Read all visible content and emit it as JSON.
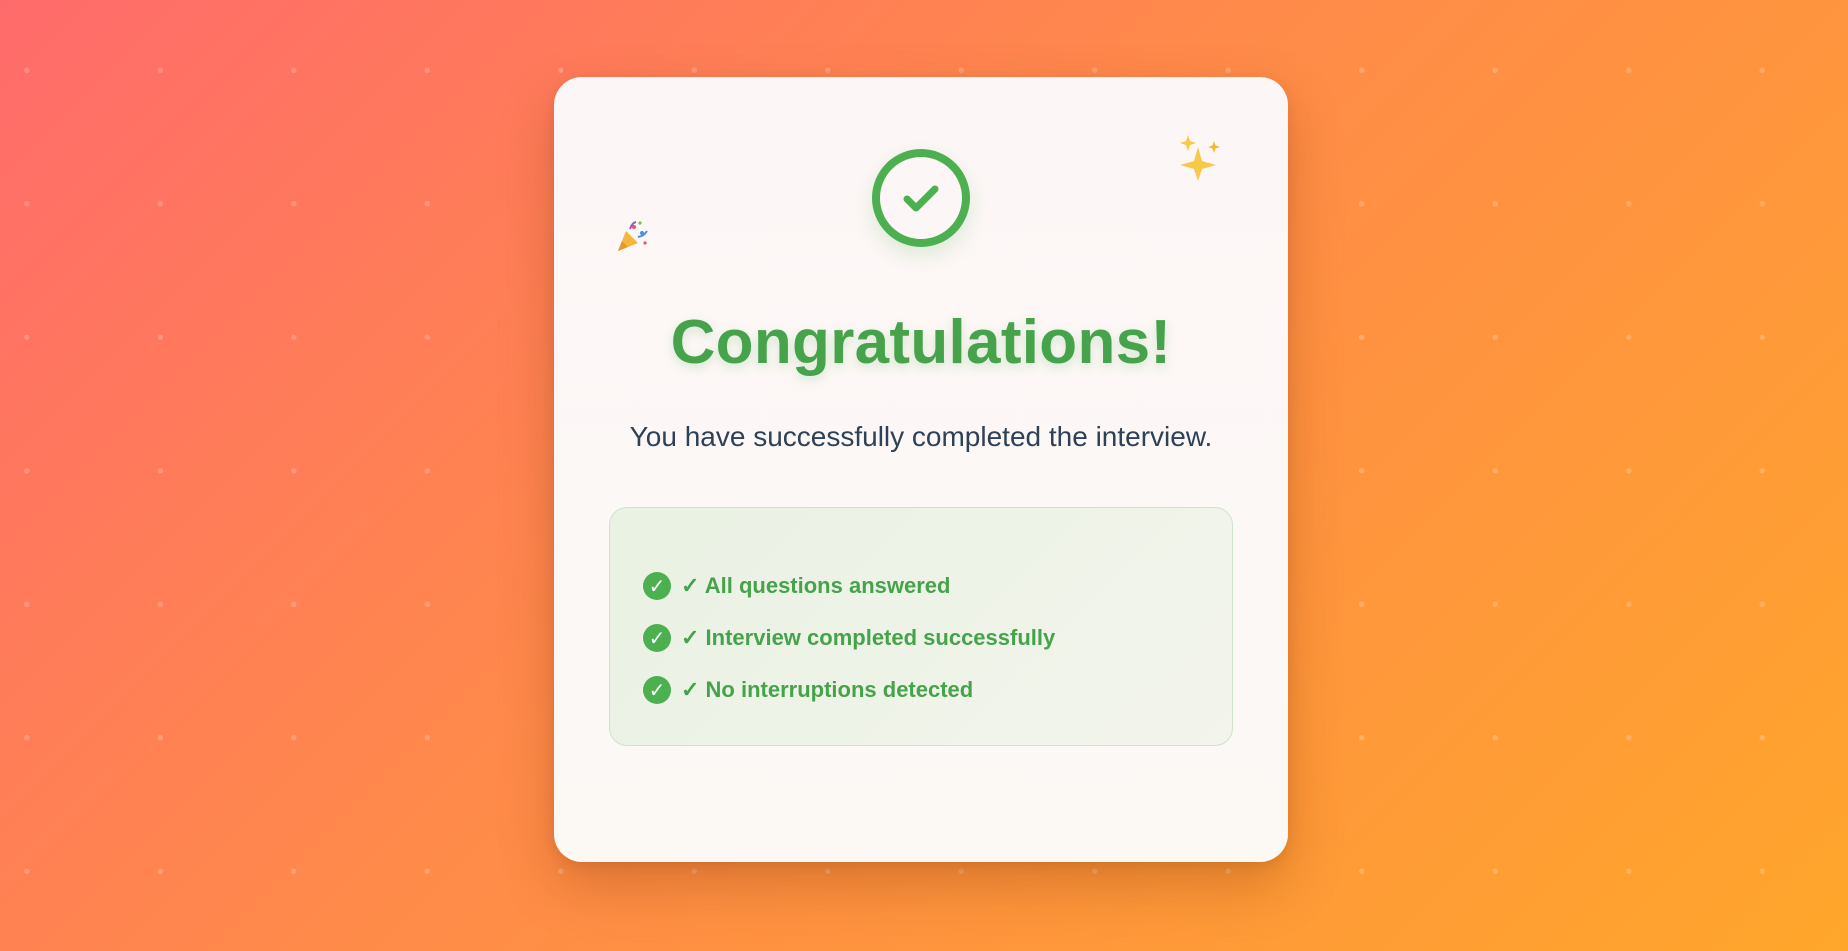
{
  "card": {
    "title": "Congratulations!",
    "subtitle": "You have successfully completed the interview.",
    "badge_icon": "check-circle-icon",
    "decorations": [
      "sparkles-icon",
      "party-popper-icon"
    ]
  },
  "checklist": {
    "items": [
      {
        "icon": "check-icon",
        "label": "✓ All questions answered"
      },
      {
        "icon": "check-icon",
        "label": "✓ Interview completed successfully"
      },
      {
        "icon": "check-icon",
        "label": "✓ No interruptions detected"
      }
    ]
  },
  "colors": {
    "accent_green": "#4caf50",
    "title_green": "#47a34b",
    "subtitle_text": "#2f4157",
    "background_start": "#ff6b6b",
    "background_end": "#ffa62b",
    "sparkle_gold": "#f7c948"
  }
}
